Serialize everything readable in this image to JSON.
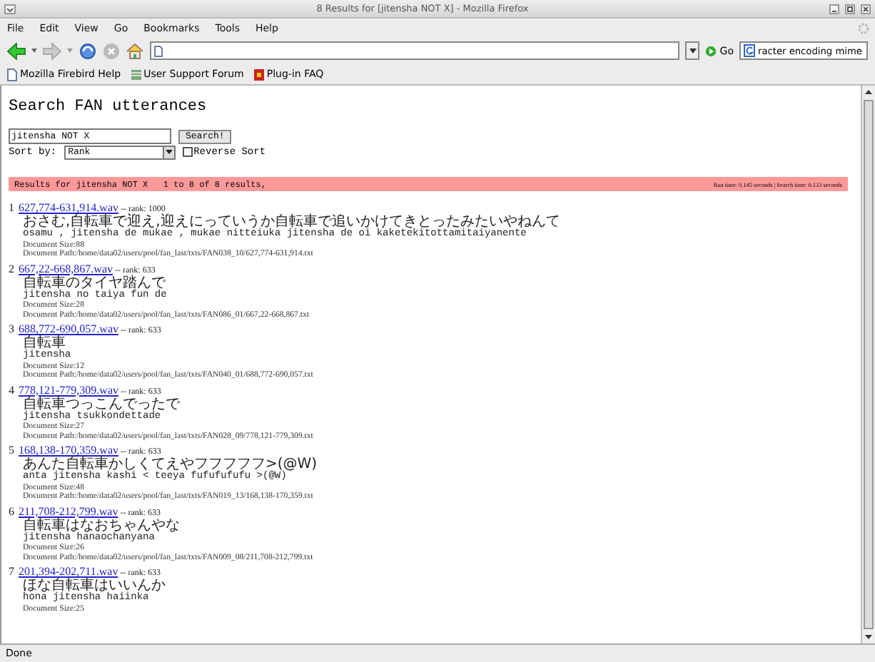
{
  "window": {
    "title": "8 Results for [jitensha NOT X] - Mozilla Firefox"
  },
  "menu": [
    "File",
    "Edit",
    "View",
    "Go",
    "Bookmarks",
    "Tools",
    "Help"
  ],
  "toolbar": {
    "go_label": "Go",
    "search_value": "racter encoding mime"
  },
  "bookmarks": [
    "Mozilla Firebird Help",
    "User Support Forum",
    "Plug-in FAQ"
  ],
  "page": {
    "heading": "Search FAN utterances",
    "query": "jitensha NOT X",
    "search_button": "Search!",
    "sort_label": "Sort by:",
    "sort_value": "Rank",
    "reverse_sort": {
      "label": "Reverse Sort",
      "checked": false
    },
    "results_bar": {
      "summary": "Results for jitensha NOT X   1 to 8 of 8 results,",
      "timing": "Run time: 0.145 seconds | Search time: 0.133 seconds"
    },
    "results": [
      {
        "number": "1",
        "link": "627,774-631,914.wav",
        "rank": "-- rank: 1000",
        "japanese": "おさむ,自転車で迎え,迎えにっていうか自転車で追いかけてきとったみたいやねんて",
        "romaji": "osamu , jitensha de mukae , mukae nitteiuka jitensha de oi kaketekitottamitaiyanente",
        "size": "Document Size:88",
        "path": "Document Path:/home/data02/users/pool/fan_last/txts/FAN038_10/627,774-631,914.txt"
      },
      {
        "number": "2",
        "link": "667,22-668,867.wav",
        "rank": "-- rank: 633",
        "japanese": "自転車のタイヤ踏んで",
        "romaji": "jitensha no taiya fun de",
        "size": "Document Size:28",
        "path": "Document Path:/home/data02/users/pool/fan_last/txts/FAN086_01/667,22-668,867.txt"
      },
      {
        "number": "3",
        "link": "688,772-690,057.wav",
        "rank": "-- rank: 633",
        "japanese": "自転車",
        "romaji": "jitensha",
        "size": "Document Size:12",
        "path": "Document Path:/home/data02/users/pool/fan_last/txts/FAN040_01/688,772-690,057.txt"
      },
      {
        "number": "4",
        "link": "778,121-779,309.wav",
        "rank": "-- rank: 633",
        "japanese": "自転車つっこんでったで",
        "romaji": "jitensha tsukkondettade",
        "size": "Document Size:27",
        "path": "Document Path:/home/data02/users/pool/fan_last/txts/FAN028_09/778,121-779,309.txt"
      },
      {
        "number": "5",
        "link": "168,138-170,359.wav",
        "rank": "-- rank: 633",
        "japanese": "あんた自転車かしくてえやフフフフフ>(@W)",
        "romaji": "anta jitensha kashi < teeya fufufufufu >(@W)",
        "size": "Document Size:48",
        "path": "Document Path:/home/data02/users/pool/fan_last/txts/FAN019_13/168,138-170,359.txt"
      },
      {
        "number": "6",
        "link": "211,708-212,799.wav",
        "rank": "-- rank: 633",
        "japanese": "自転車はなおちゃんやな",
        "romaji": "jitensha hanaochanyana",
        "size": "Document Size:26",
        "path": "Document Path:/home/data02/users/pool/fan_last/txts/FAN009_08/211,708-212,799.txt"
      },
      {
        "number": "7",
        "link": "201,394-202,711.wav",
        "rank": "-- rank: 633",
        "japanese": "ほな自転車はいいんか",
        "romaji": "hona jitensha haiinka",
        "size": "Document Size:25"
      }
    ]
  },
  "status_bar": "Done"
}
